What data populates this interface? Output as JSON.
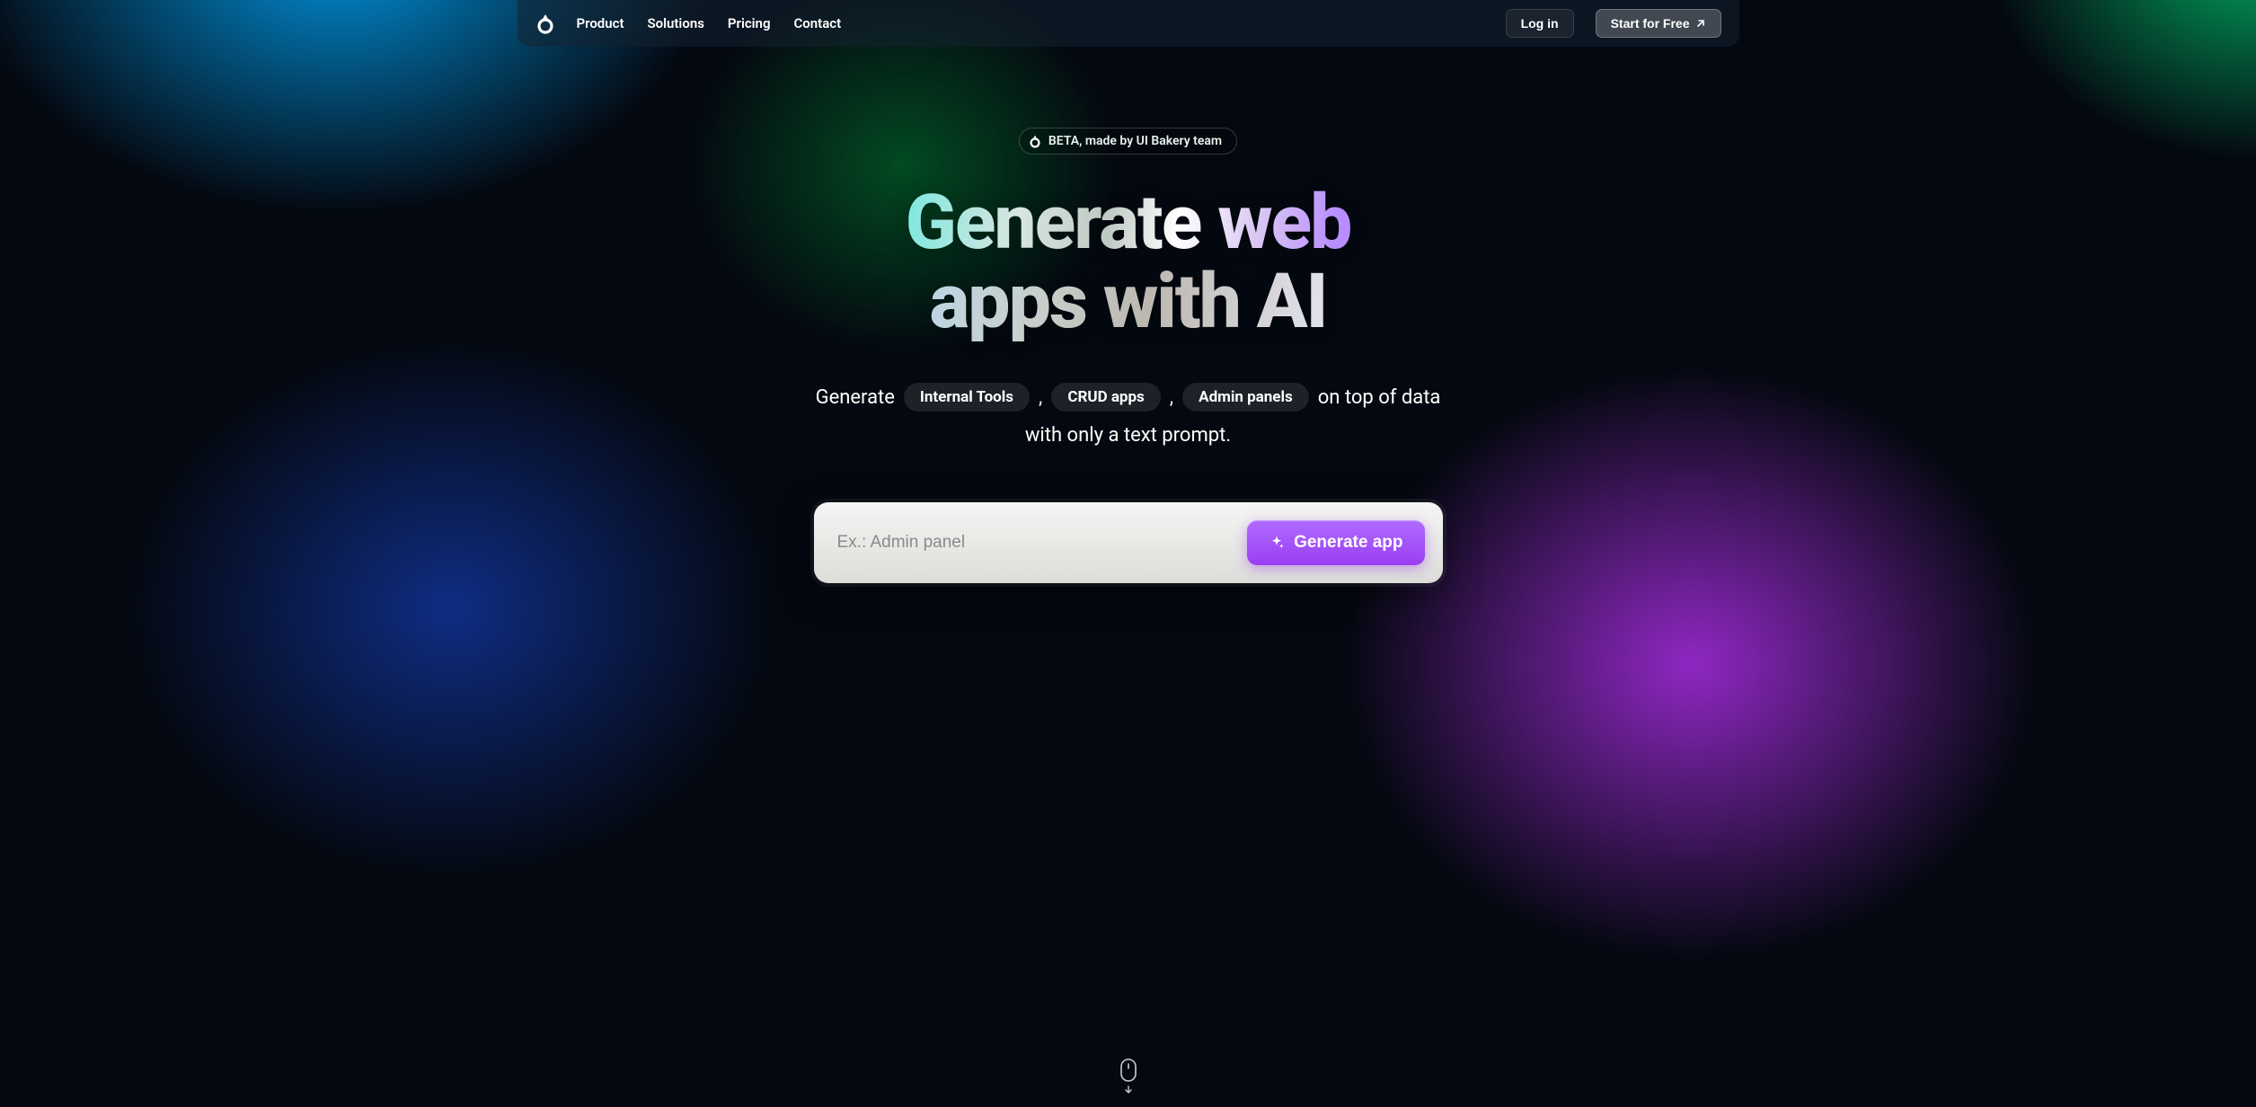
{
  "nav": {
    "links": [
      "Product",
      "Solutions",
      "Pricing",
      "Contact"
    ],
    "login_label": "Log in",
    "start_label": "Start for Free"
  },
  "hero": {
    "beta_label": "BETA, made by UI Bakery team",
    "title_line1": "Generate web",
    "title_line2": "apps with AI",
    "sub_lead": "Generate",
    "chips": [
      "Internal Tools",
      "CRUD apps",
      "Admin panels"
    ],
    "chip_separator": ",",
    "sub_trail": "on top of data",
    "sub_line2": "with only a text prompt."
  },
  "prompt": {
    "placeholder": "Ex.: Admin panel",
    "button_label": "Generate app"
  }
}
